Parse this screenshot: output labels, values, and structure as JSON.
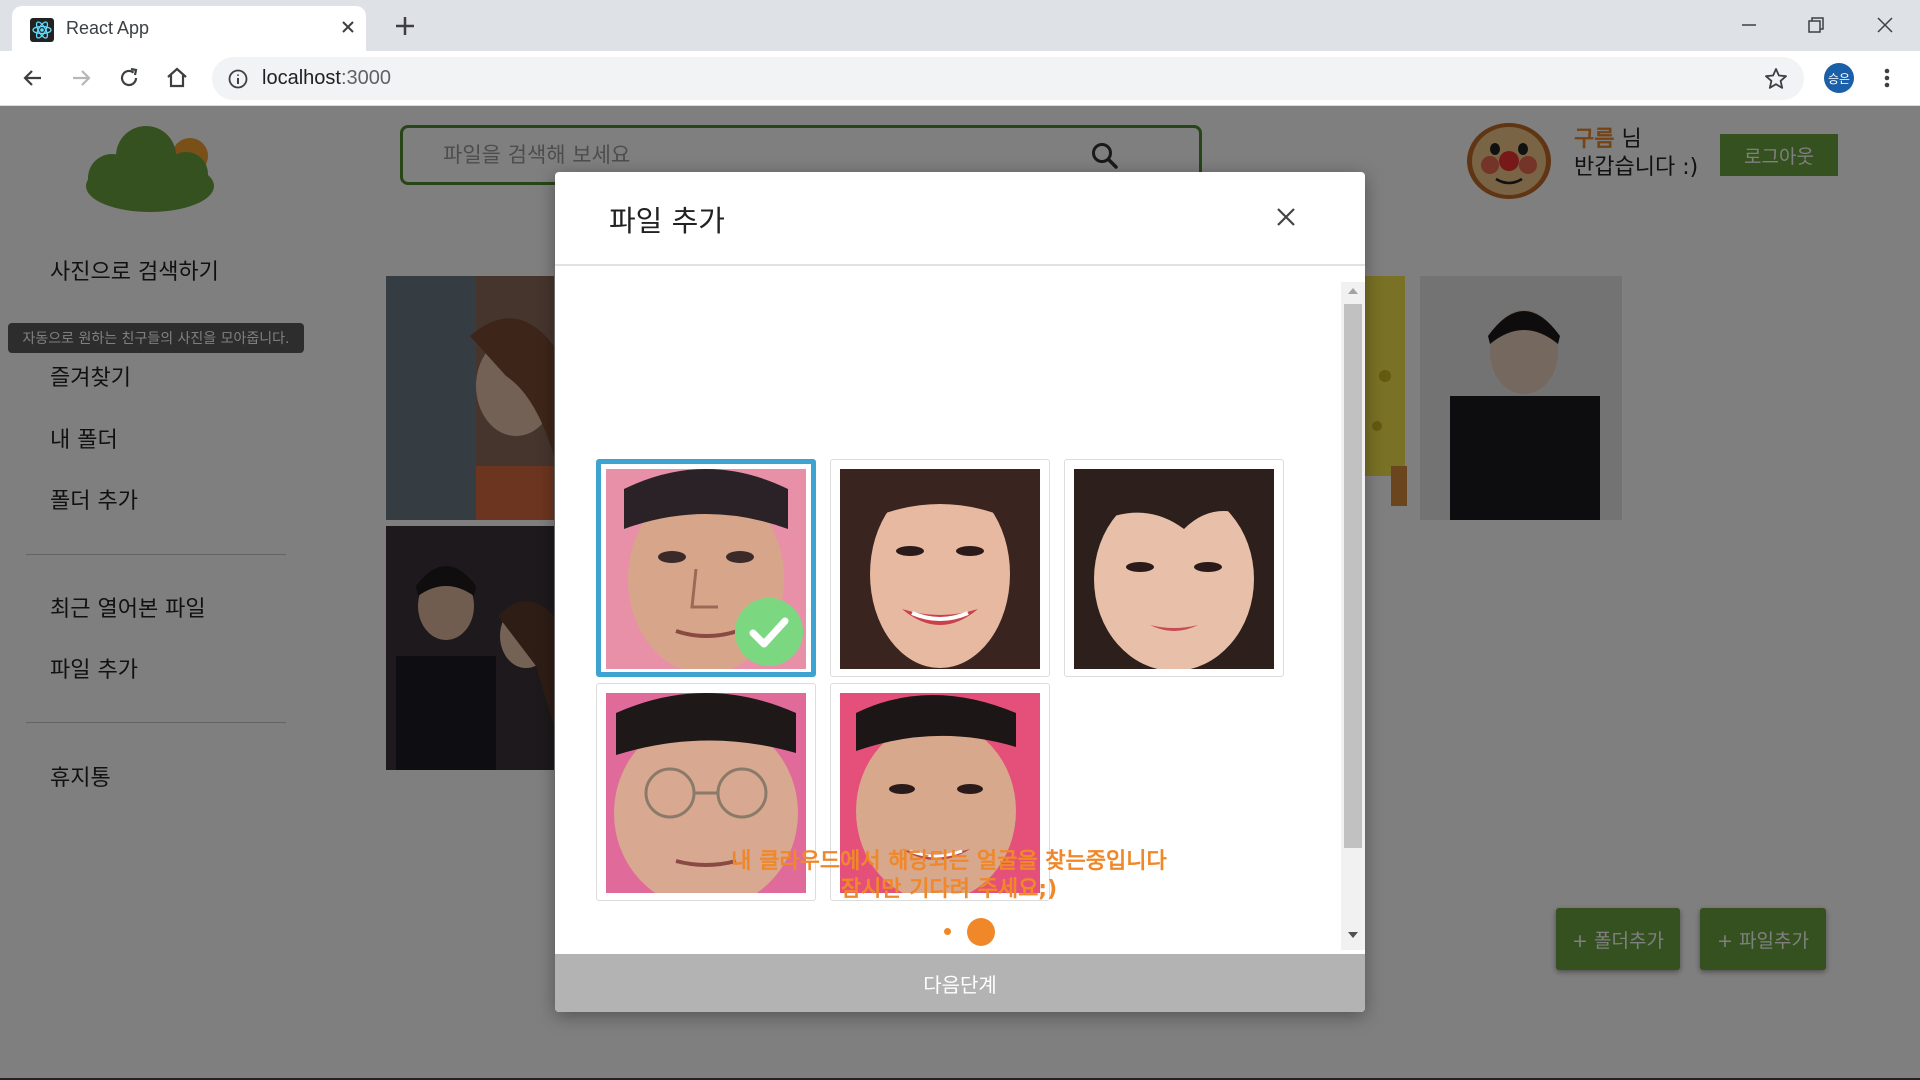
{
  "browser": {
    "tab_title": "React App",
    "url_host": "localhost",
    "url_port": ":3000",
    "profile_initials": "승은"
  },
  "header": {
    "search_placeholder": "파일을 검색해 보세요",
    "user_name": "구름",
    "user_suffix": " 님",
    "greeting": "반갑습니다 :)",
    "logout_label": "로그아웃"
  },
  "sidebar": {
    "items": [
      {
        "label": "사진으로 검색하기"
      },
      {
        "label": "즐겨찾기"
      },
      {
        "label": "내 폴더"
      },
      {
        "label": "폴더 추가"
      },
      {
        "label": "최근 열어본 파일"
      },
      {
        "label": "파일 추가"
      },
      {
        "label": "휴지통"
      }
    ],
    "tooltip": "자동으로 원하는 친구들의 사진을 모아줍니다."
  },
  "actions": {
    "add_folder": "+ 폴더추가",
    "add_file": "+ 파일추가"
  },
  "modal": {
    "title": "파일 추가",
    "status_line1": "내 클라우드에서 해당되는 얼굴을 찾는중입니다",
    "status_line2": "잠시만 기다려 주세요;)",
    "next_label": "다음단계",
    "faces": [
      {
        "selected": true
      },
      {
        "selected": false
      },
      {
        "selected": false
      },
      {
        "selected": false
      },
      {
        "selected": false
      }
    ]
  },
  "colors": {
    "brand_green": "#6aa33e",
    "accent_orange": "#f0882a",
    "selection_blue": "#3ea3d0",
    "check_green": "#7cd880"
  },
  "icons": [
    "react-favicon-icon",
    "close-icon",
    "plus-icon",
    "minimize-icon",
    "restore-icon",
    "back-icon",
    "forward-icon",
    "reload-icon",
    "home-icon",
    "info-icon",
    "star-icon",
    "menu-icon",
    "search-icon",
    "cloud-logo-icon",
    "check-icon"
  ]
}
